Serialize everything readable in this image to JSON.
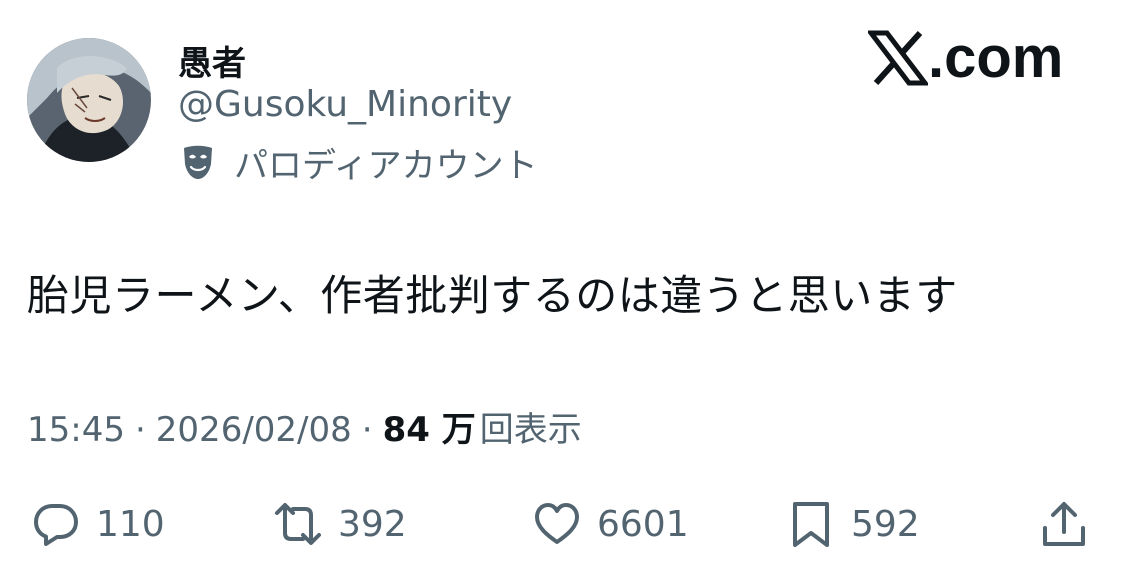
{
  "tweet": {
    "display_name": "愚者",
    "handle": "@Gusoku_Minority",
    "parody_label": "パロディアカウント",
    "text": "胎児ラーメン、作者批判するのは違うと思います",
    "time": "15:45",
    "separator": "·",
    "date": "2026/02/08",
    "views_count": "84 万",
    "views_label": "回表示"
  },
  "brand": {
    "text": ".com",
    "logo": "x-logo"
  },
  "actions": {
    "reply_count": "110",
    "retweet_count": "392",
    "like_count": "6601",
    "bookmark_count": "592"
  },
  "icons": {
    "reply": "reply-icon",
    "retweet": "retweet-icon",
    "like": "heart-icon",
    "bookmark": "bookmark-icon",
    "share": "share-icon",
    "parody": "parody-mask-icon"
  },
  "colors": {
    "text_primary": "#0f1419",
    "text_secondary": "#536471",
    "background": "#ffffff"
  }
}
